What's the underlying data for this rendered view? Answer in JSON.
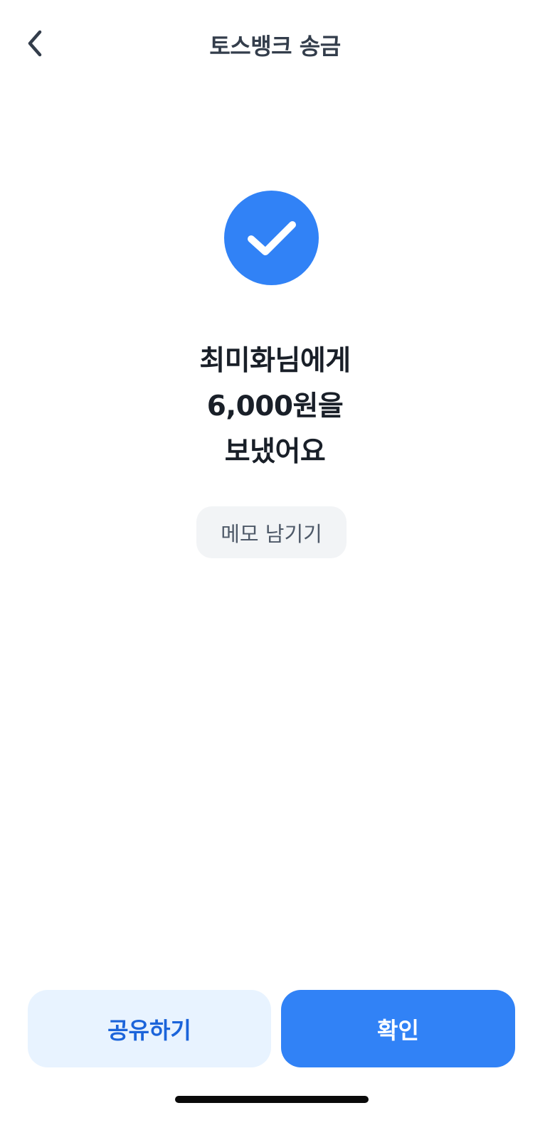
{
  "header": {
    "title": "토스뱅크 송금",
    "back_icon": "chevron-left-icon"
  },
  "result": {
    "status_icon": "check-icon",
    "accent_color": "#3182f6",
    "line1": "최미화님에게",
    "line2": "6,000원을",
    "line3": "보냈어요"
  },
  "memo": {
    "label": "메모 남기기"
  },
  "actions": {
    "share_label": "공유하기",
    "confirm_label": "확인"
  }
}
